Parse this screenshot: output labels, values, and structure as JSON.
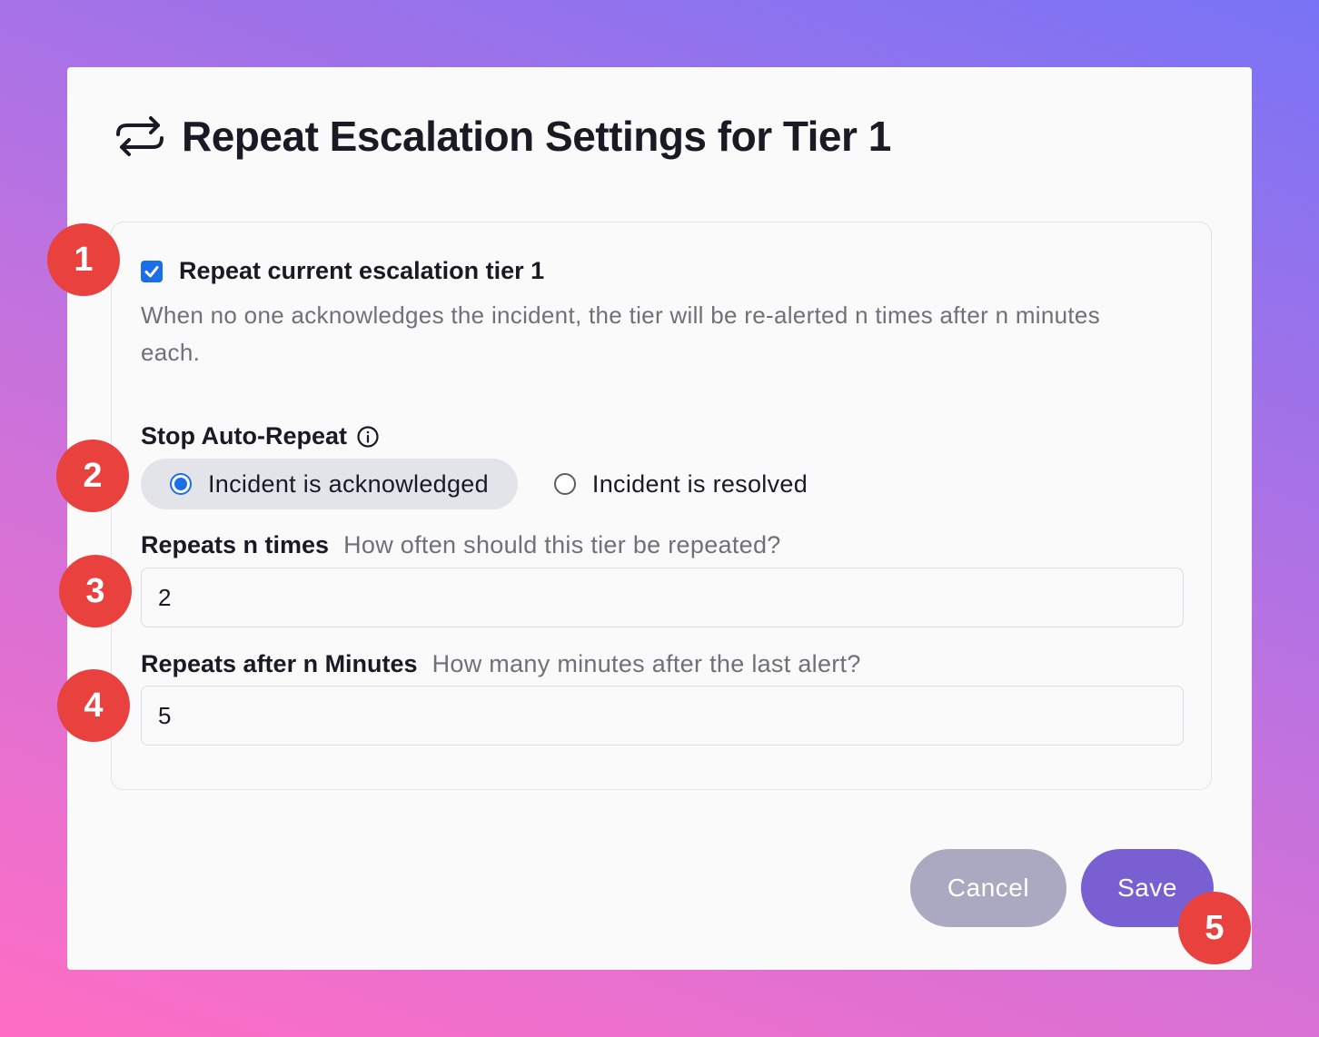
{
  "dialog": {
    "title": "Repeat Escalation Settings for Tier 1",
    "title_icon": "repeat-icon"
  },
  "repeat": {
    "checkbox_label": "Repeat current escalation tier 1",
    "checked": true,
    "description": "When no one acknowledges the incident, the tier will be re-alerted n times after n minutes each."
  },
  "stop_auto_repeat": {
    "label": "Stop Auto-Repeat",
    "info_icon": "info-icon",
    "options": [
      {
        "label": "Incident is acknowledged",
        "selected": true
      },
      {
        "label": "Incident is resolved",
        "selected": false
      }
    ]
  },
  "repeats_times": {
    "label": "Repeats n times",
    "hint": "How often should this tier be repeated?",
    "value": "2"
  },
  "repeats_minutes": {
    "label": "Repeats after n Minutes",
    "hint": "How many minutes after the last alert?",
    "value": "5"
  },
  "buttons": {
    "cancel": "Cancel",
    "save": "Save"
  },
  "badges": [
    "1",
    "2",
    "3",
    "4",
    "5"
  ],
  "colors": {
    "accent": "#1a6fe8",
    "save": "#7a5fd3",
    "cancel": "#aba8c2",
    "badge": "#e8413e"
  }
}
